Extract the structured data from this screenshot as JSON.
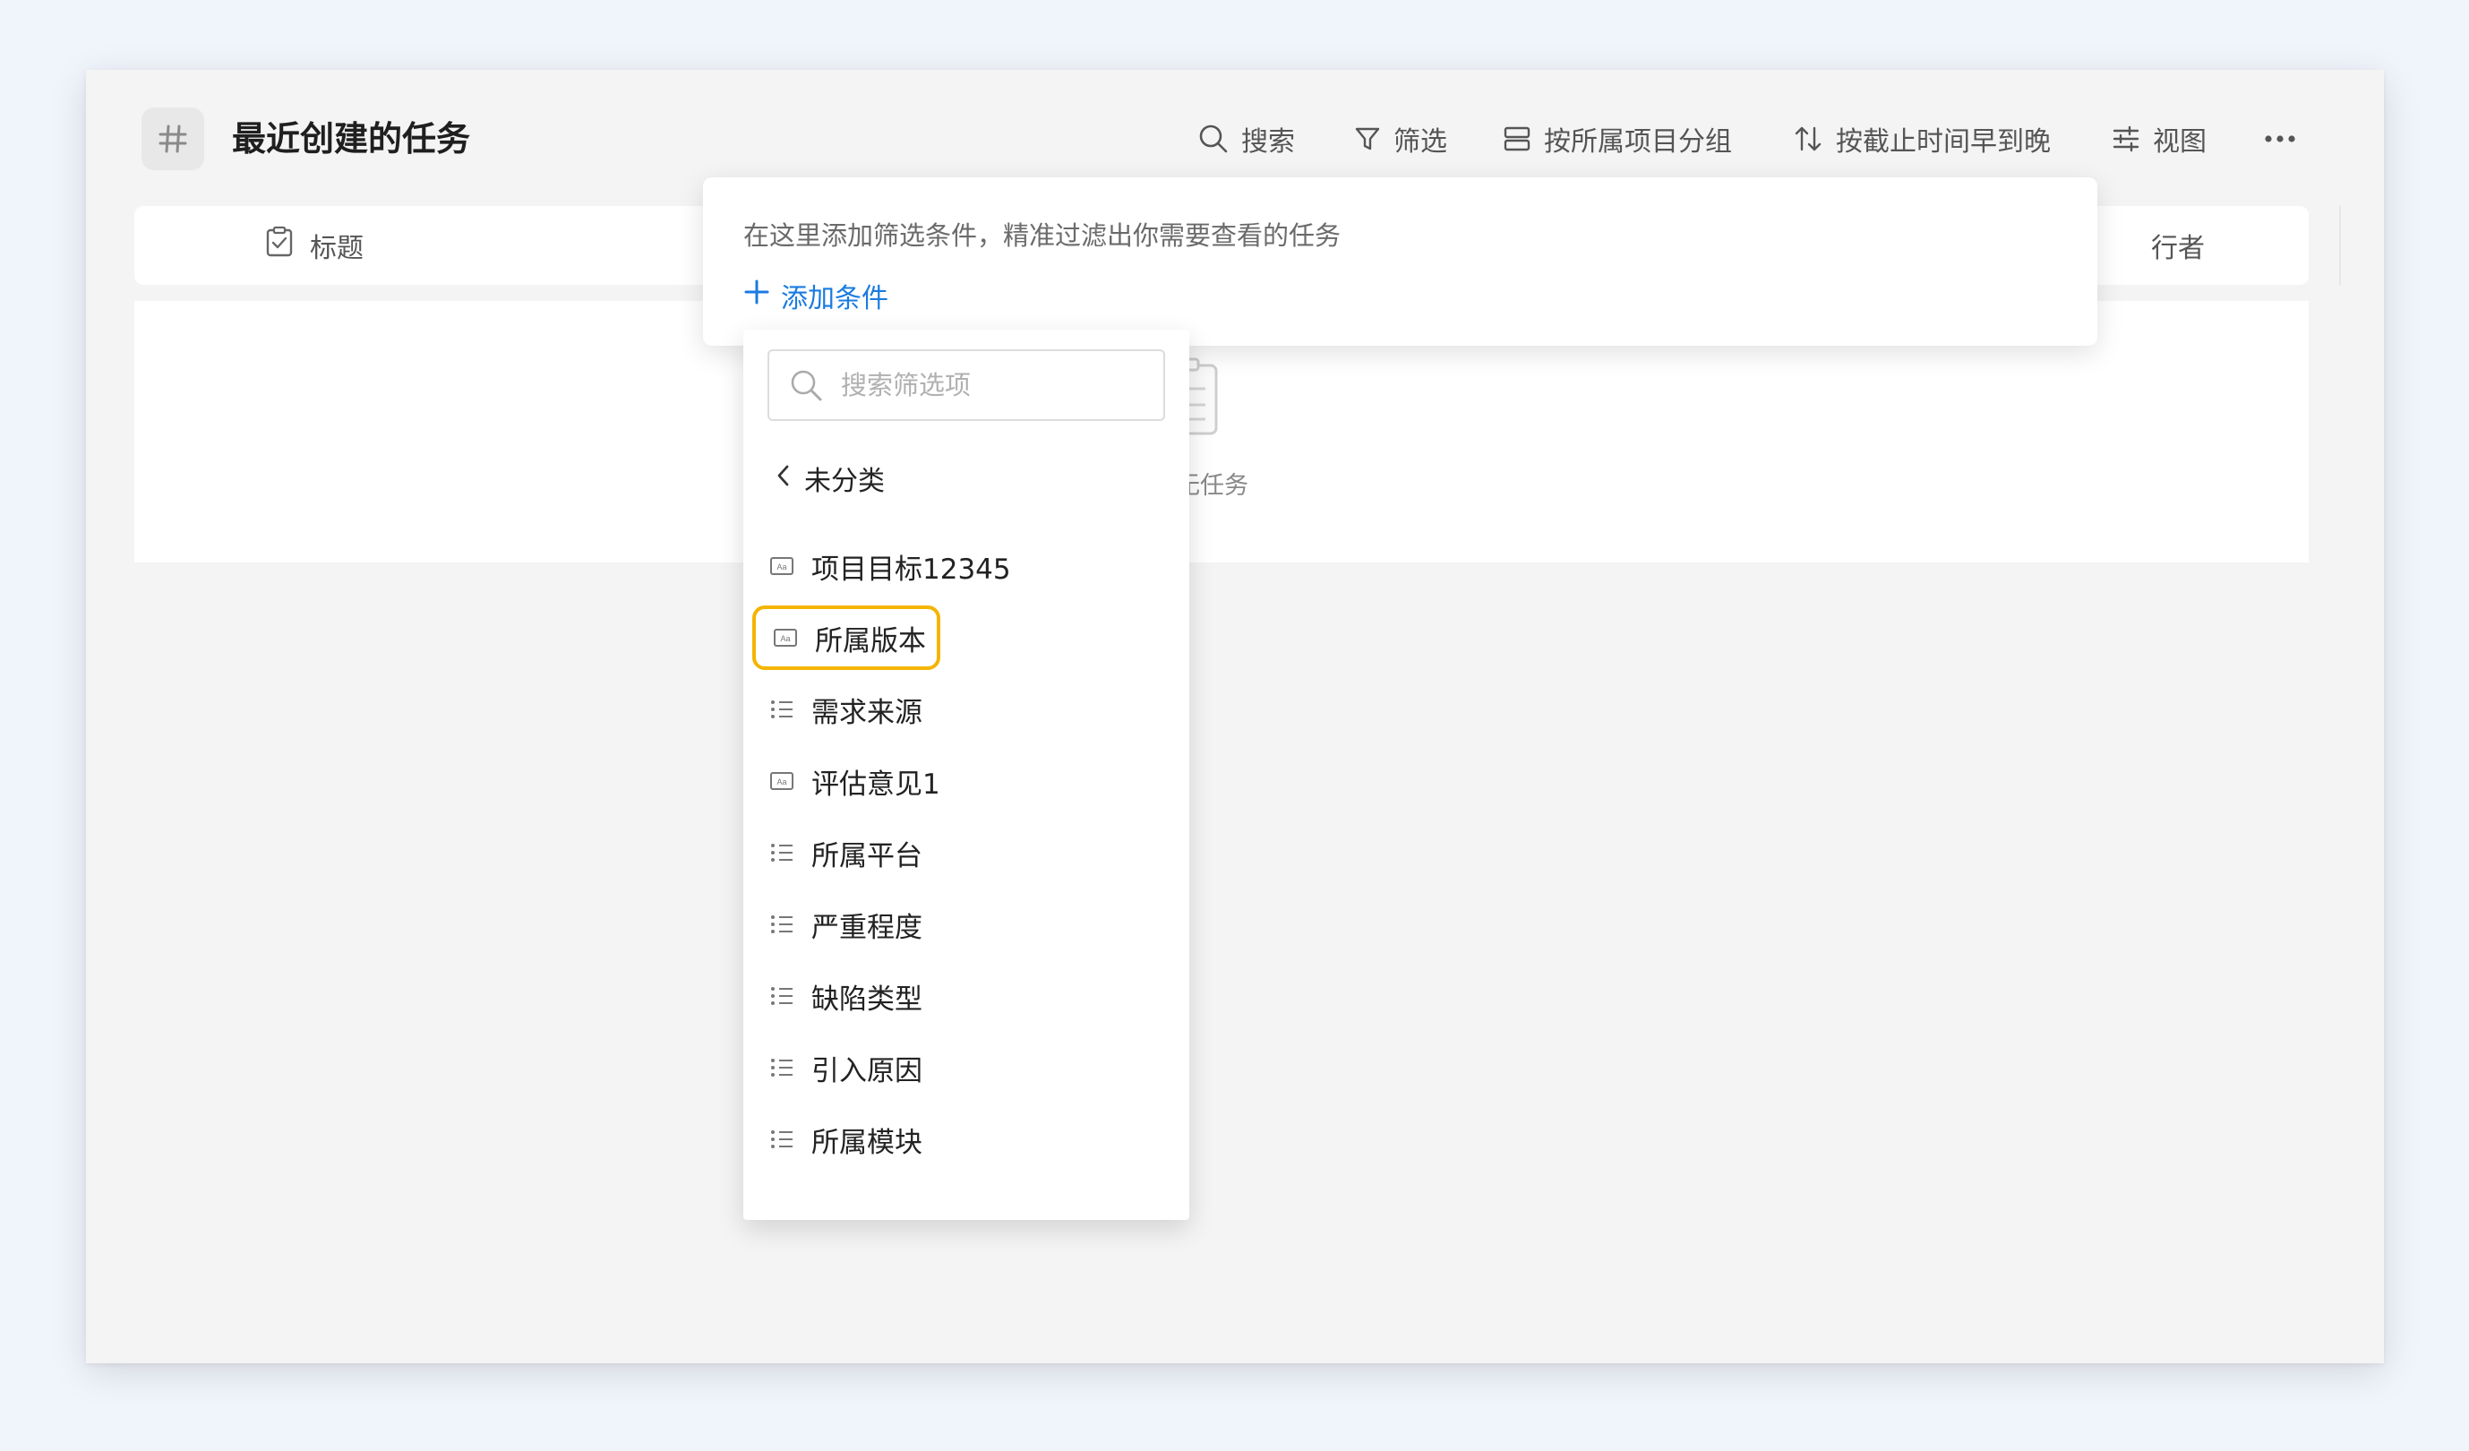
{
  "page": {
    "title": "最近创建的任务"
  },
  "toolbar": {
    "search": "搜索",
    "filter": "筛选",
    "group": "按所属项目分组",
    "sort": "按截止时间早到晚",
    "view": "视图"
  },
  "table": {
    "col_title": "标题",
    "col_executor_partial": "行者"
  },
  "empty": {
    "text_partial": "暂无任务"
  },
  "filter": {
    "hint": "在这里添加筛选条件，精准过滤出你需要查看的任务",
    "add_condition": "添加条件"
  },
  "dropdown": {
    "search_placeholder": "搜索筛选项",
    "back_label": "未分类",
    "options": [
      {
        "label": "项目目标12345",
        "icon": "text-field-icon"
      },
      {
        "label": "所属版本",
        "icon": "text-field-icon",
        "highlighted": true
      },
      {
        "label": "需求来源",
        "icon": "list-field-icon"
      },
      {
        "label": "评估意见1",
        "icon": "text-field-icon"
      },
      {
        "label": "所属平台",
        "icon": "list-field-icon"
      },
      {
        "label": "严重程度",
        "icon": "list-field-icon"
      },
      {
        "label": "缺陷类型",
        "icon": "list-field-icon"
      },
      {
        "label": "引入原因",
        "icon": "list-field-icon"
      },
      {
        "label": "所属模块",
        "icon": "list-field-icon"
      }
    ]
  },
  "colors": {
    "accent": "#1a7be0",
    "highlight": "#f5b400"
  }
}
